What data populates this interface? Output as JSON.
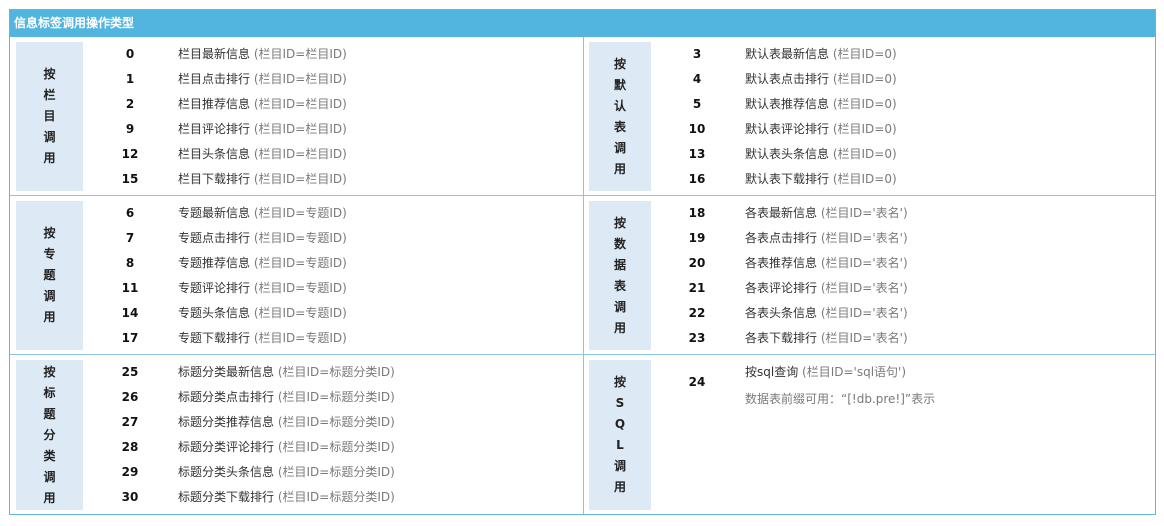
{
  "title": "信息标签调用操作类型",
  "sections": [
    {
      "category": [
        "按",
        "栏",
        "目",
        "调",
        "用"
      ],
      "rows": [
        {
          "num": "0",
          "text": "栏目最新信息",
          "hint": "(栏目ID=栏目ID)"
        },
        {
          "num": "1",
          "text": "栏目点击排行",
          "hint": "(栏目ID=栏目ID)"
        },
        {
          "num": "2",
          "text": "栏目推荐信息",
          "hint": "(栏目ID=栏目ID)"
        },
        {
          "num": "9",
          "text": "栏目评论排行",
          "hint": "(栏目ID=栏目ID)"
        },
        {
          "num": "12",
          "text": "栏目头条信息",
          "hint": "(栏目ID=栏目ID)"
        },
        {
          "num": "15",
          "text": "栏目下载排行",
          "hint": "(栏目ID=栏目ID)"
        }
      ]
    },
    {
      "category": [
        "按",
        "默",
        "认",
        "表",
        "调",
        "用"
      ],
      "rows": [
        {
          "num": "3",
          "text": "默认表最新信息",
          "hint": "(栏目ID=0)"
        },
        {
          "num": "4",
          "text": "默认表点击排行",
          "hint": "(栏目ID=0)"
        },
        {
          "num": "5",
          "text": "默认表推荐信息",
          "hint": "(栏目ID=0)"
        },
        {
          "num": "10",
          "text": "默认表评论排行",
          "hint": "(栏目ID=0)"
        },
        {
          "num": "13",
          "text": "默认表头条信息",
          "hint": "(栏目ID=0)"
        },
        {
          "num": "16",
          "text": "默认表下载排行",
          "hint": "(栏目ID=0)"
        }
      ]
    },
    {
      "category": [
        "按",
        "专",
        "题",
        "调",
        "用"
      ],
      "rows": [
        {
          "num": "6",
          "text": "专题最新信息",
          "hint": "(栏目ID=专题ID)"
        },
        {
          "num": "7",
          "text": "专题点击排行",
          "hint": "(栏目ID=专题ID)"
        },
        {
          "num": "8",
          "text": "专题推荐信息",
          "hint": "(栏目ID=专题ID)"
        },
        {
          "num": "11",
          "text": "专题评论排行",
          "hint": "(栏目ID=专题ID)"
        },
        {
          "num": "14",
          "text": "专题头条信息",
          "hint": "(栏目ID=专题ID)"
        },
        {
          "num": "17",
          "text": "专题下载排行",
          "hint": "(栏目ID=专题ID)"
        }
      ]
    },
    {
      "category": [
        "按",
        "数",
        "据",
        "表",
        "调",
        "用"
      ],
      "rows": [
        {
          "num": "18",
          "text": "各表最新信息",
          "hint": "(栏目ID='表名')"
        },
        {
          "num": "19",
          "text": "各表点击排行",
          "hint": "(栏目ID='表名')"
        },
        {
          "num": "20",
          "text": "各表推荐信息",
          "hint": "(栏目ID='表名')"
        },
        {
          "num": "21",
          "text": "各表评论排行",
          "hint": "(栏目ID='表名')"
        },
        {
          "num": "22",
          "text": "各表头条信息",
          "hint": "(栏目ID='表名')"
        },
        {
          "num": "23",
          "text": "各表下载排行",
          "hint": "(栏目ID='表名')"
        }
      ]
    },
    {
      "category": [
        "按",
        "标",
        "题",
        "分",
        "类",
        "调",
        "用"
      ],
      "rows": [
        {
          "num": "25",
          "text": "标题分类最新信息",
          "hint": "(栏目ID=标题分类ID)"
        },
        {
          "num": "26",
          "text": "标题分类点击排行",
          "hint": "(栏目ID=标题分类ID)"
        },
        {
          "num": "27",
          "text": "标题分类推荐信息",
          "hint": "(栏目ID=标题分类ID)"
        },
        {
          "num": "28",
          "text": "标题分类评论排行",
          "hint": "(栏目ID=标题分类ID)"
        },
        {
          "num": "29",
          "text": "标题分类头条信息",
          "hint": "(栏目ID=标题分类ID)"
        },
        {
          "num": "30",
          "text": "标题分类下载排行",
          "hint": "(栏目ID=标题分类ID)"
        }
      ]
    },
    {
      "category": [
        "按",
        "S",
        "Q",
        "L",
        "调",
        "用"
      ],
      "rows": [
        {
          "num": "24",
          "text": "按sql查询",
          "hint": "(栏目ID='sql语句')"
        }
      ],
      "note": "数据表前缀可用：“[!db.pre!]”表示"
    }
  ]
}
